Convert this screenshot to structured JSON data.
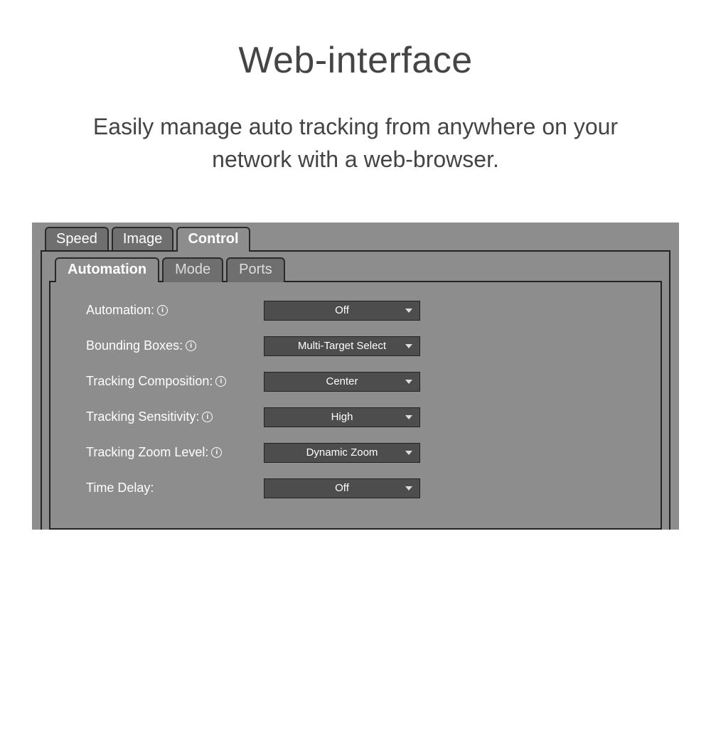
{
  "header": {
    "title": "Web-interface",
    "subtitle": "Easily manage auto tracking from anywhere on your network with a web-browser."
  },
  "topTabs": [
    {
      "label": "Speed",
      "active": false
    },
    {
      "label": "Image",
      "active": false
    },
    {
      "label": "Control",
      "active": true
    }
  ],
  "subTabs": [
    {
      "label": "Automation",
      "active": true
    },
    {
      "label": "Mode",
      "active": false
    },
    {
      "label": "Ports",
      "active": false
    }
  ],
  "form": {
    "rows": [
      {
        "label": "Automation:",
        "hasInfo": true,
        "value": "Off"
      },
      {
        "label": "Bounding Boxes:",
        "hasInfo": true,
        "value": "Multi-Target Select"
      },
      {
        "label": "Tracking Composition:",
        "hasInfo": true,
        "value": "Center"
      },
      {
        "label": "Tracking Sensitivity:",
        "hasInfo": true,
        "value": "High"
      },
      {
        "label": "Tracking Zoom Level:",
        "hasInfo": true,
        "value": "Dynamic Zoom"
      },
      {
        "label": "Time Delay:",
        "hasInfo": false,
        "value": "Off"
      }
    ]
  },
  "infoGlyph": "i"
}
